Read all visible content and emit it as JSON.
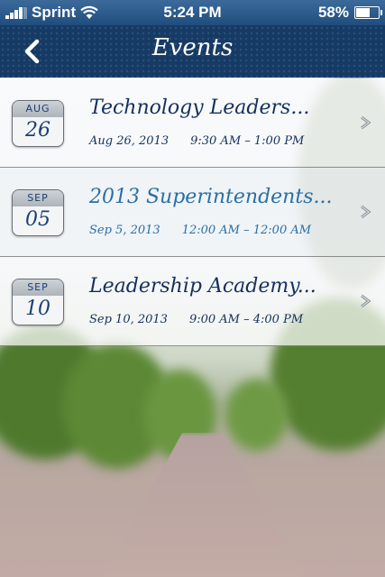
{
  "status_bar": {
    "carrier": "Sprint",
    "time": "5:24 PM",
    "battery": "58%",
    "battery_level": 0.58
  },
  "nav": {
    "title": "Events"
  },
  "events": [
    {
      "month": "AUG",
      "day": "26",
      "title": "Technology Leaders...",
      "date": "Aug 26, 2013",
      "time": "9:30 AM – 1:00 PM"
    },
    {
      "month": "SEP",
      "day": "05",
      "title": "2013 Superintendents...",
      "date": "Sep 5, 2013",
      "time": "12:00 AM – 12:00 AM"
    },
    {
      "month": "SEP",
      "day": "10",
      "title": "Leadership Academy...",
      "date": "Sep 10, 2013",
      "time": "9:00 AM – 4:00 PM"
    }
  ],
  "colors": {
    "nav_bg": "#163a63",
    "status_bg": "#1f4d7e",
    "text_dark": "#15305c",
    "text_highlight": "#2a6fa6"
  }
}
